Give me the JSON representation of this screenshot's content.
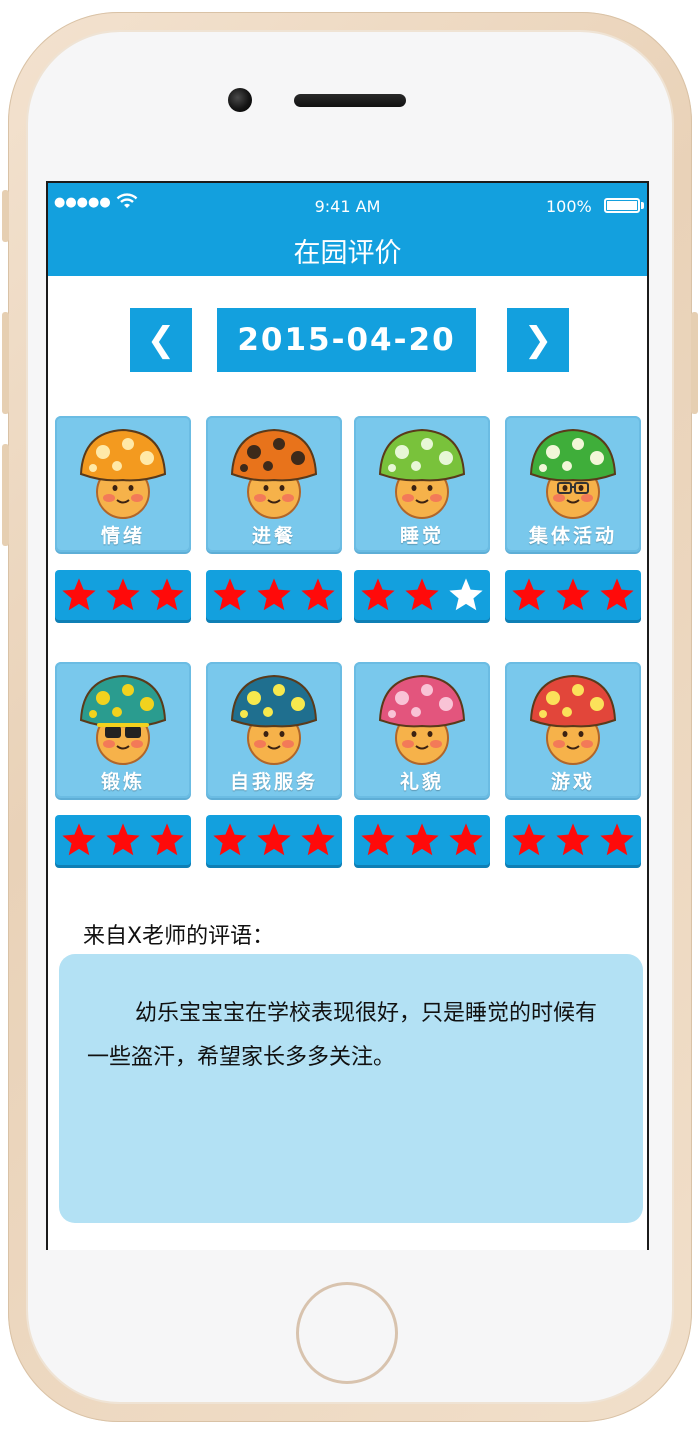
{
  "status_bar": {
    "signal": "●●●●●",
    "time": "9:41 AM",
    "battery": "100%",
    "battery_level": 1.0
  },
  "navbar": {
    "title": "在园评价"
  },
  "date_nav": {
    "prev": "❮",
    "date": "2015-04-20",
    "next": "❯"
  },
  "categories": [
    {
      "label": "情绪",
      "rating": 3,
      "max": 3,
      "cap": "#f39a1f",
      "spots": "#ffe9a8"
    },
    {
      "label": "进餐",
      "rating": 3,
      "max": 3,
      "cap": "#e8731b",
      "spots": "#3d2a1a"
    },
    {
      "label": "睡觉",
      "rating": 2,
      "max": 3,
      "cap": "#79c23b",
      "spots": "#e7f7d6"
    },
    {
      "label": "集体活动",
      "rating": 3,
      "max": 3,
      "cap": "#3fae3a",
      "spots": "#f2f7d8"
    },
    {
      "label": "锻炼",
      "rating": 3,
      "max": 3,
      "cap": "#2a9c8f",
      "spots": "#f2d21e"
    },
    {
      "label": "自我服务",
      "rating": 3,
      "max": 3,
      "cap": "#1f6f8f",
      "spots": "#f7e84d"
    },
    {
      "label": "礼貌",
      "rating": 3,
      "max": 3,
      "cap": "#e3557d",
      "spots": "#f9c3d6"
    },
    {
      "label": "游戏",
      "rating": 3,
      "max": 3,
      "cap": "#e2463a",
      "spots": "#fbe15a"
    }
  ],
  "star_colors": {
    "filled": "#ff0a0a",
    "empty": "#ffffff"
  },
  "comment": {
    "title": "来自X老师的评语：",
    "text": "幼乐宝宝宝在学校表现很好，只是睡觉的时候有一些盗汗，希望家长多多关注。"
  },
  "colors": {
    "accent": "#13a0de",
    "card": "#79c8ec",
    "comment_bg": "#b3e1f4"
  }
}
